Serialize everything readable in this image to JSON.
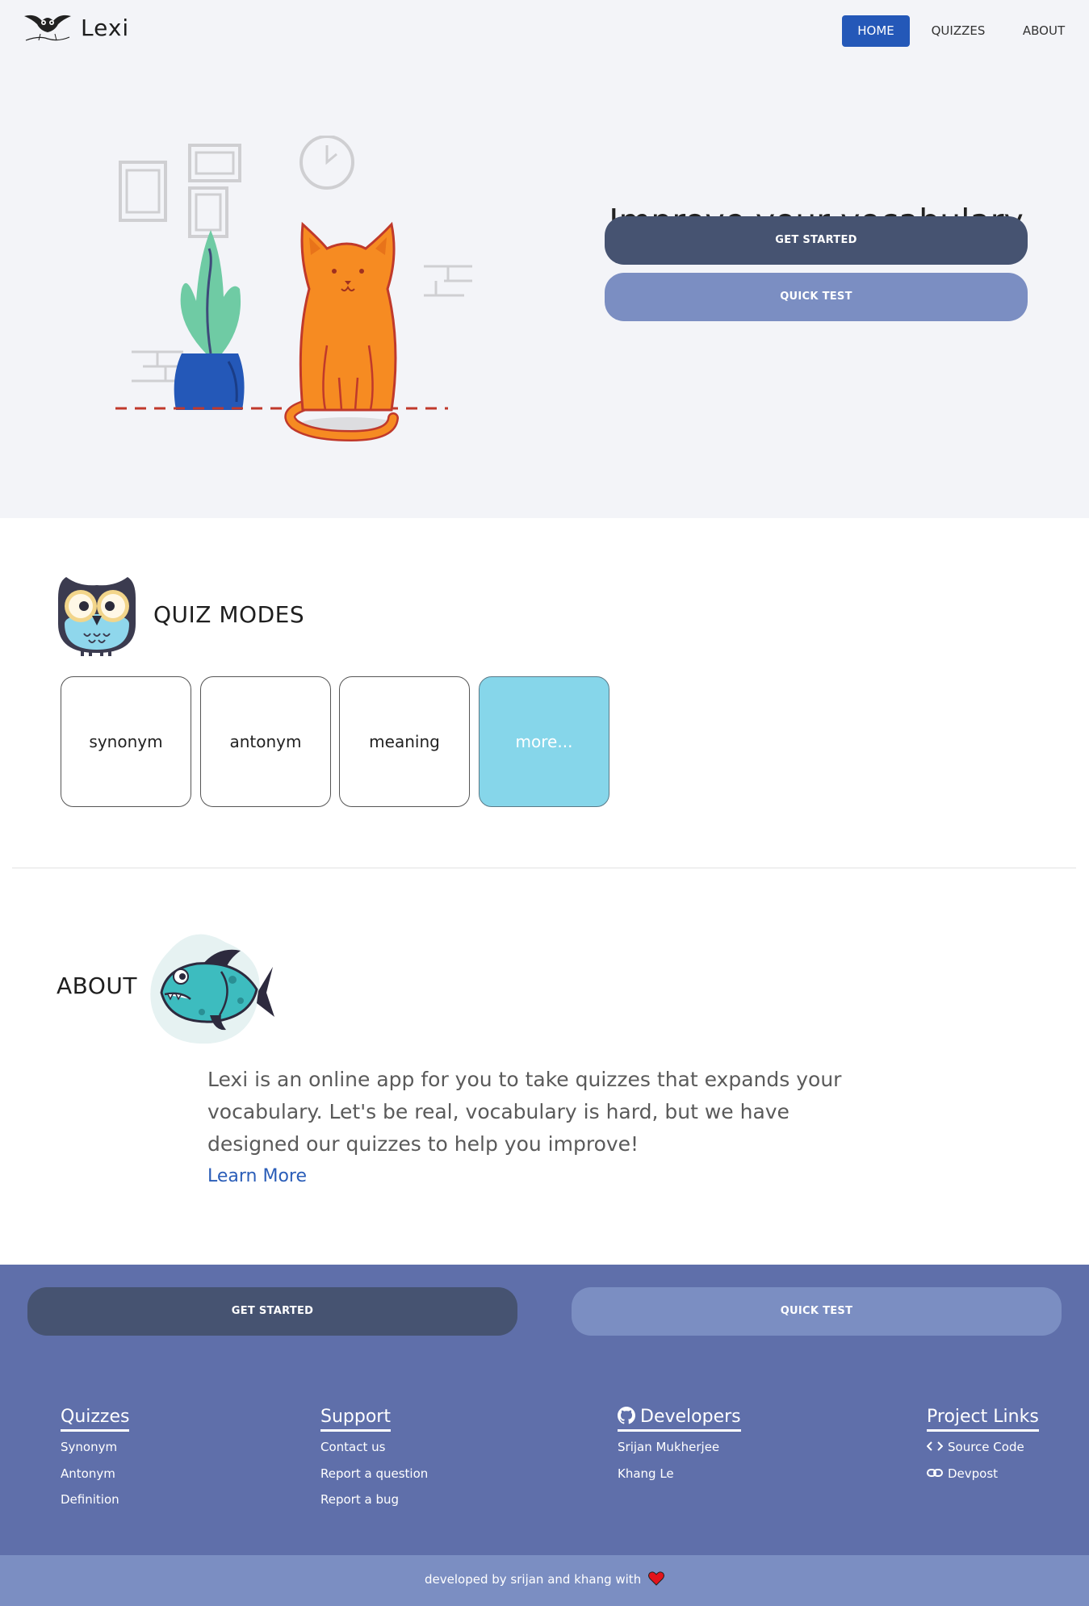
{
  "nav": {
    "brand": "Lexi",
    "home": "HOME",
    "quizzes": "QUIZZES",
    "about": "ABOUT"
  },
  "hero": {
    "title": "Improve your vocabulary",
    "get_started": "GET STARTED",
    "quick_test": "QUICK TEST"
  },
  "quiz_modes": {
    "title": "QUIZ MODES",
    "modes": [
      "synonym",
      "antonym",
      "meaning",
      "more..."
    ]
  },
  "about": {
    "title": "ABOUT",
    "text": "Lexi is an online app for you to take quizzes that expands your vocabulary. Let's be real, vocabulary is hard, but we have designed our quizzes to help you improve!",
    "learn_more": "Learn More"
  },
  "footer": {
    "get_started": "GET STARTED",
    "quick_test": "QUICK TEST",
    "columns": [
      {
        "title": "Quizzes",
        "links": [
          "Synonym",
          "Antonym",
          "Definition"
        ]
      },
      {
        "title": "Support",
        "links": [
          "Contact us",
          "Report a question",
          "Report a bug"
        ]
      },
      {
        "title": "Developers",
        "icon": "github-icon",
        "links": [
          "Srijan Mukherjee",
          "Khang Le"
        ]
      },
      {
        "title": "Project Links",
        "links": [
          "Source Code",
          "Devpost"
        ],
        "link_icons": [
          "code-icon",
          "link-icon"
        ]
      }
    ],
    "credit": "developed by srijan and khang with"
  },
  "colors": {
    "primary_blue": "#2458b8",
    "dark_button": "#465371",
    "light_button": "#7b8ec2",
    "footer_bg": "#5f6faa",
    "more_tile": "#86d6ea",
    "hero_bg": "#f3f4f8"
  }
}
